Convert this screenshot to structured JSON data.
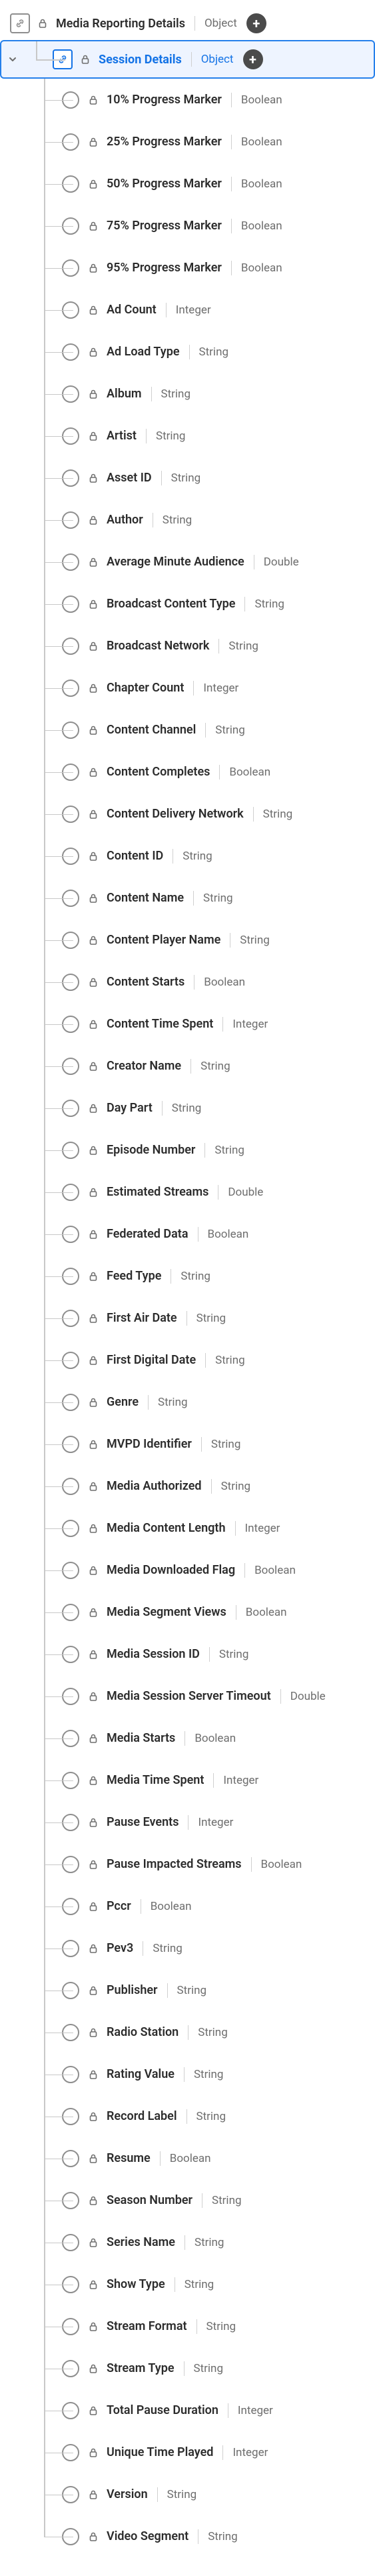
{
  "root": {
    "label": "Media Reporting Details",
    "type": "Object",
    "hasAdd": true,
    "hasLock": true,
    "isObject": true,
    "selected": false
  },
  "child": {
    "label": "Session Details",
    "type": "Object",
    "hasAdd": true,
    "hasLock": true,
    "isObject": true,
    "selected": true
  },
  "fields": [
    {
      "label": "10% Progress Marker",
      "type": "Boolean"
    },
    {
      "label": "25% Progress Marker",
      "type": "Boolean"
    },
    {
      "label": "50% Progress Marker",
      "type": "Boolean"
    },
    {
      "label": "75% Progress Marker",
      "type": "Boolean"
    },
    {
      "label": "95% Progress Marker",
      "type": "Boolean"
    },
    {
      "label": "Ad Count",
      "type": "Integer"
    },
    {
      "label": "Ad Load Type",
      "type": "String"
    },
    {
      "label": "Album",
      "type": "String"
    },
    {
      "label": "Artist",
      "type": "String"
    },
    {
      "label": "Asset ID",
      "type": "String"
    },
    {
      "label": "Author",
      "type": "String"
    },
    {
      "label": "Average Minute Audience",
      "type": "Double"
    },
    {
      "label": "Broadcast Content Type",
      "type": "String"
    },
    {
      "label": "Broadcast Network",
      "type": "String"
    },
    {
      "label": "Chapter Count",
      "type": "Integer"
    },
    {
      "label": "Content Channel",
      "type": "String"
    },
    {
      "label": "Content Completes",
      "type": "Boolean"
    },
    {
      "label": "Content Delivery Network",
      "type": "String"
    },
    {
      "label": "Content ID",
      "type": "String"
    },
    {
      "label": "Content Name",
      "type": "String"
    },
    {
      "label": "Content Player Name",
      "type": "String"
    },
    {
      "label": "Content Starts",
      "type": "Boolean"
    },
    {
      "label": "Content Time Spent",
      "type": "Integer"
    },
    {
      "label": "Creator Name",
      "type": "String"
    },
    {
      "label": "Day Part",
      "type": "String"
    },
    {
      "label": "Episode Number",
      "type": "String"
    },
    {
      "label": "Estimated Streams",
      "type": "Double"
    },
    {
      "label": "Federated Data",
      "type": "Boolean"
    },
    {
      "label": "Feed Type",
      "type": "String"
    },
    {
      "label": "First Air Date",
      "type": "String"
    },
    {
      "label": "First Digital Date",
      "type": "String"
    },
    {
      "label": "Genre",
      "type": "String"
    },
    {
      "label": "MVPD Identifier",
      "type": "String"
    },
    {
      "label": "Media Authorized",
      "type": "String"
    },
    {
      "label": "Media Content Length",
      "type": "Integer"
    },
    {
      "label": "Media Downloaded Flag",
      "type": "Boolean"
    },
    {
      "label": "Media Segment Views",
      "type": "Boolean"
    },
    {
      "label": "Media Session ID",
      "type": "String"
    },
    {
      "label": "Media Session Server Timeout",
      "type": "Double"
    },
    {
      "label": "Media Starts",
      "type": "Boolean"
    },
    {
      "label": "Media Time Spent",
      "type": "Integer"
    },
    {
      "label": "Pause Events",
      "type": "Integer"
    },
    {
      "label": "Pause Impacted Streams",
      "type": "Boolean"
    },
    {
      "label": "Pccr",
      "type": "Boolean"
    },
    {
      "label": "Pev3",
      "type": "String"
    },
    {
      "label": "Publisher",
      "type": "String"
    },
    {
      "label": "Radio Station",
      "type": "String"
    },
    {
      "label": "Rating Value",
      "type": "String"
    },
    {
      "label": "Record Label",
      "type": "String"
    },
    {
      "label": "Resume",
      "type": "Boolean"
    },
    {
      "label": "Season Number",
      "type": "String"
    },
    {
      "label": "Series Name",
      "type": "String"
    },
    {
      "label": "Show Type",
      "type": "String"
    },
    {
      "label": "Stream Format",
      "type": "String"
    },
    {
      "label": "Stream Type",
      "type": "String"
    },
    {
      "label": "Total Pause Duration",
      "type": "Integer"
    },
    {
      "label": "Unique Time Played",
      "type": "Integer"
    },
    {
      "label": "Version",
      "type": "String"
    },
    {
      "label": "Video Segment",
      "type": "String"
    }
  ]
}
